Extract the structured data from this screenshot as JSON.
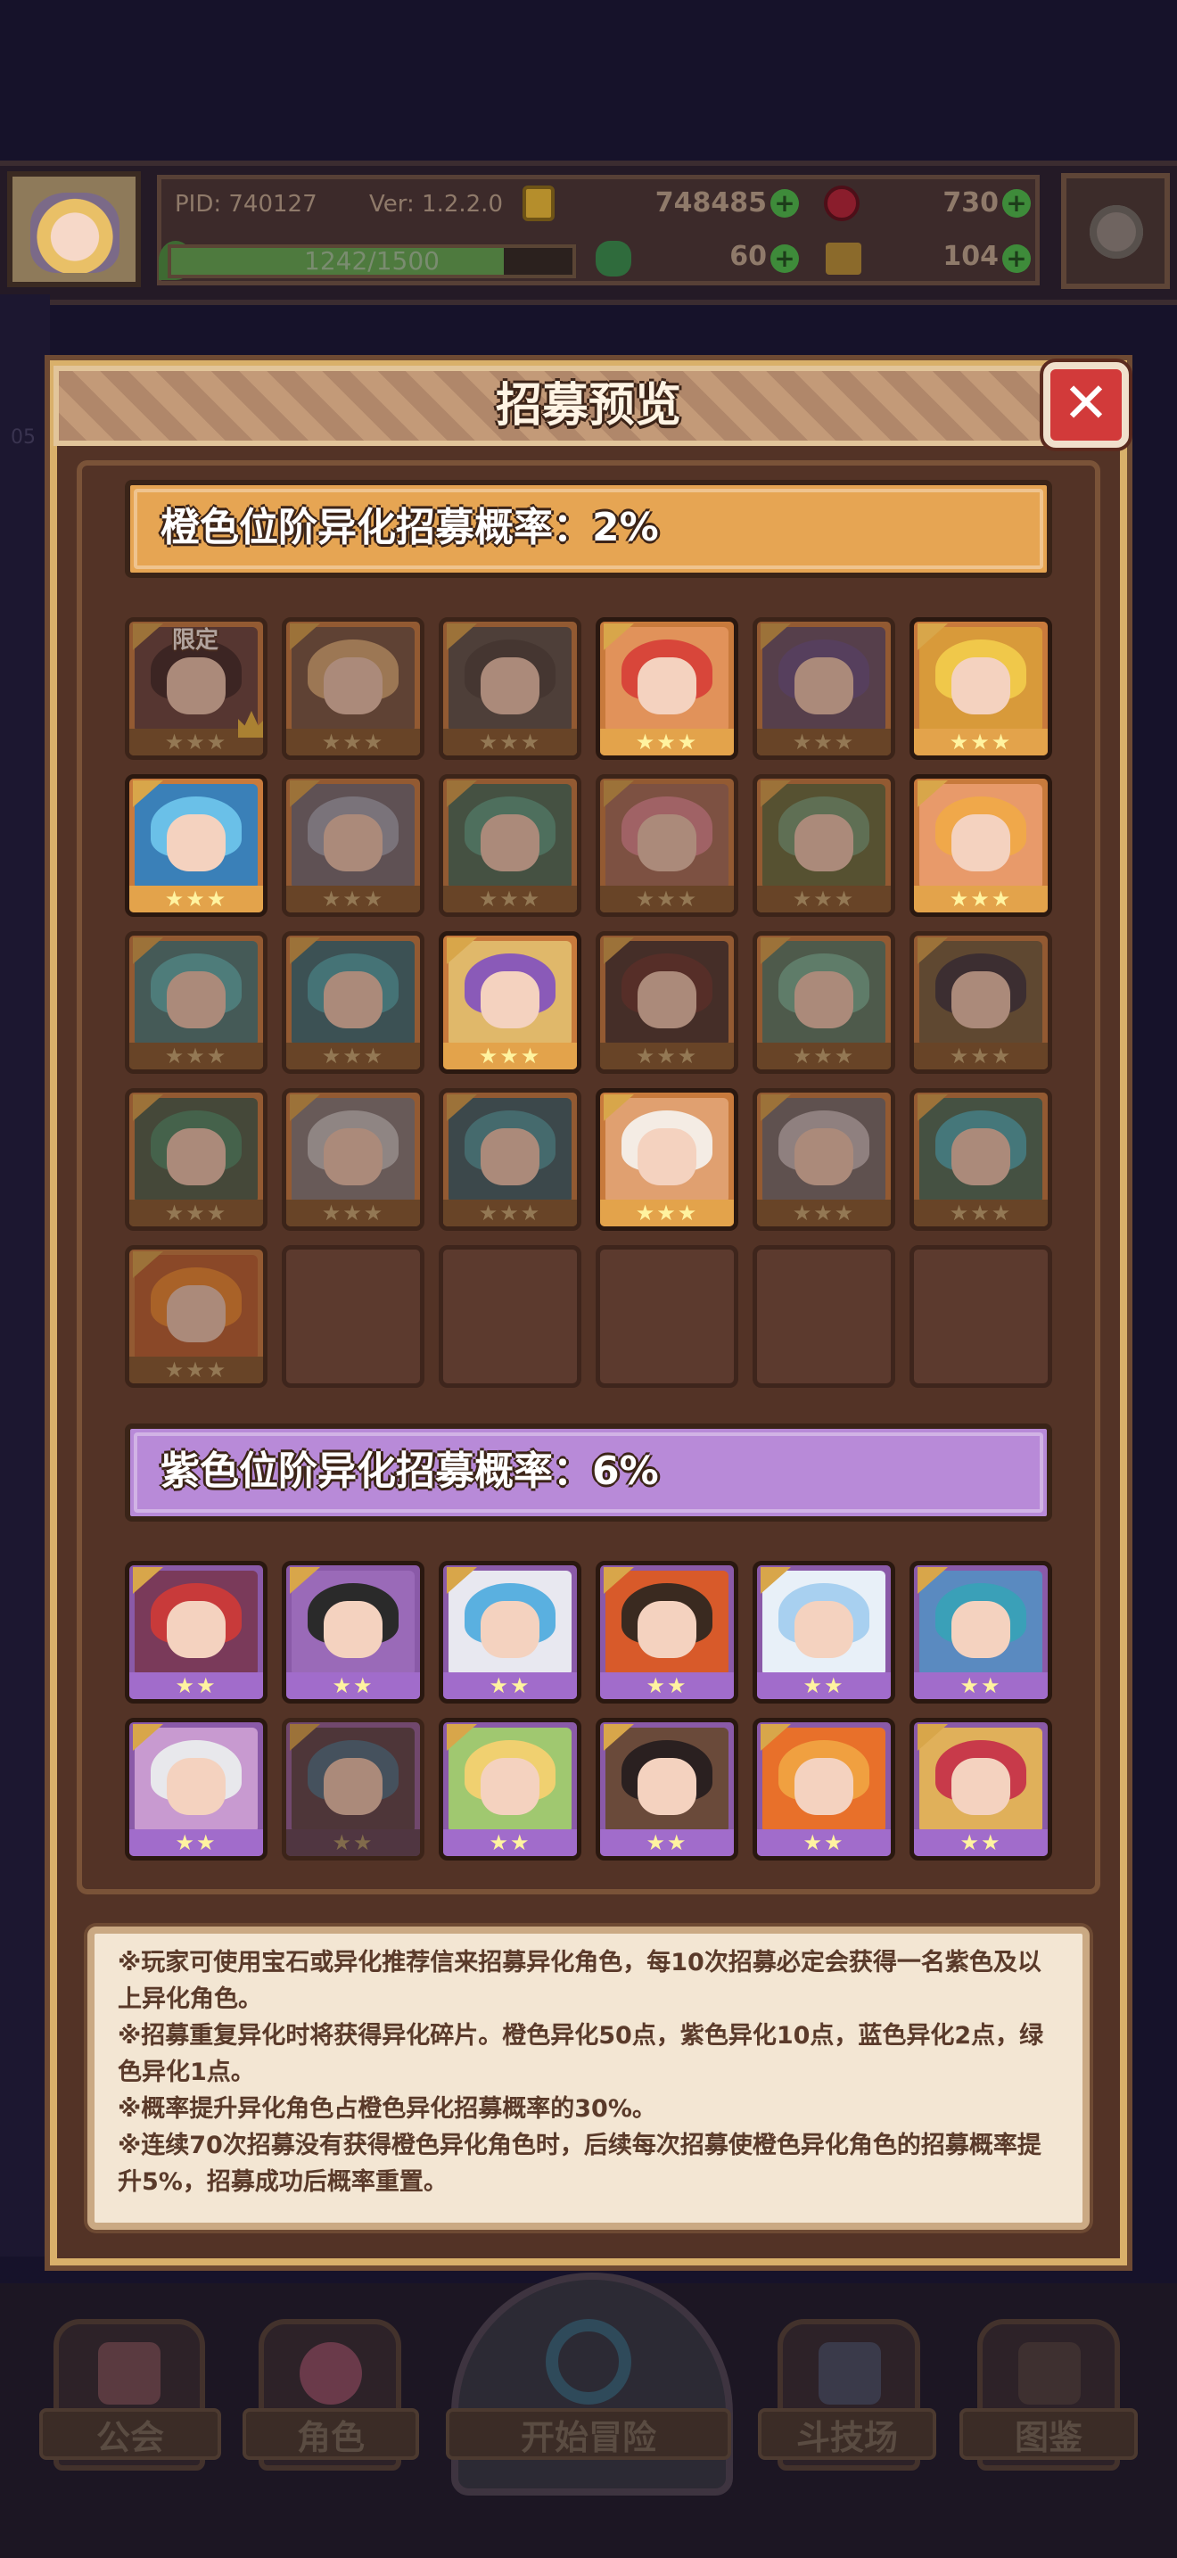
{
  "status": {
    "pid": "PID: 740127",
    "version": "Ver: 1.2.2.0",
    "gold": "748485",
    "gems": "730",
    "stamina": "1242/1500",
    "stamina_progress": 0.828,
    "clovers": "60",
    "keys": "104"
  },
  "modal": {
    "title": "招募预览",
    "close_icon": "✕"
  },
  "orange_tier": {
    "label": "橙色位阶异化招募概率：2%",
    "limited_tag": "限定",
    "stars": "★★★",
    "color": "#e6a553",
    "cards": [
      {
        "hair": "#2a1a22",
        "art": "#5a3a3a",
        "dim": true,
        "limited": true
      },
      {
        "hair": "#d9b07a",
        "art": "#6a5040",
        "dim": true
      },
      {
        "hair": "#3a3a3a",
        "art": "#4a4a4a",
        "dim": true
      },
      {
        "hair": "#d8463a",
        "art": "#e1925a",
        "dim": false
      },
      {
        "hair": "#5a4a8a",
        "art": "#5a4a6a",
        "dim": true
      },
      {
        "hair": "#f0c84a",
        "art": "#d89a3a",
        "dim": false
      },
      {
        "hair": "#6ac0e8",
        "art": "#3a80b8",
        "dim": false
      },
      {
        "hair": "#9aa8c0",
        "art": "#6a6a7a",
        "dim": true
      },
      {
        "hair": "#4aa08a",
        "art": "#3a6a5a",
        "dim": true
      },
      {
        "hair": "#e08a9a",
        "art": "#a06a5a",
        "dim": true
      },
      {
        "hair": "#6aa07a",
        "art": "#5a6a3a",
        "dim": true
      },
      {
        "hair": "#f0a84a",
        "art": "#e89a6a",
        "dim": false
      },
      {
        "hair": "#4ab8c0",
        "art": "#3a7a80",
        "dim": true
      },
      {
        "hair": "#3aa8b8",
        "art": "#2a6a7a",
        "dim": true
      },
      {
        "hair": "#8a5ab8",
        "art": "#e0b86a",
        "dim": false
      },
      {
        "hair": "#5a2a2a",
        "art": "#3a2a2a",
        "dim": true
      },
      {
        "hair": "#6ab8a0",
        "art": "#4a7a6a",
        "dim": true
      },
      {
        "hair": "#2a2a3a",
        "art": "#6a5a3a",
        "dim": true
      },
      {
        "hair": "#3a8a6a",
        "art": "#3a5a4a",
        "dim": true
      },
      {
        "hair": "#c0c8d0",
        "art": "#7a7a82",
        "dim": true
      },
      {
        "hair": "#3a98a8",
        "art": "#2a5a6a",
        "dim": true
      },
      {
        "hair": "#f4ece4",
        "art": "#e0a070",
        "dim": false
      },
      {
        "hair": "#c0c0c8",
        "art": "#6a6a72",
        "dim": true
      },
      {
        "hair": "#3ab0c0",
        "art": "#3a6a5a",
        "dim": true
      },
      {
        "hair": "#f08a2a",
        "art": "#b85a2a",
        "dim": true
      }
    ]
  },
  "purple_tier": {
    "label": "紫色位阶异化招募概率：6%",
    "stars": "★★",
    "color": "#b88ad8",
    "cards": [
      {
        "hair": "#c83a3a",
        "art": "#7a3a5a",
        "dim": false
      },
      {
        "hair": "#2a2a2a",
        "art": "#9a6ab8",
        "dim": false
      },
      {
        "hair": "#5ab0e0",
        "art": "#e8e8f0",
        "dim": false
      },
      {
        "hair": "#3a2a20",
        "art": "#d85a2a",
        "dim": false
      },
      {
        "hair": "#a8d0f0",
        "art": "#e8f0f8",
        "dim": false
      },
      {
        "hair": "#3aa0b8",
        "art": "#5a8ac0",
        "dim": false
      },
      {
        "hair": "#e8e8ec",
        "art": "#c89ad0",
        "dim": false
      },
      {
        "hair": "#3a6a8a",
        "art": "#4a3a4a",
        "dim": true
      },
      {
        "hair": "#f0d070",
        "art": "#a0c870",
        "dim": false
      },
      {
        "hair": "#2a2020",
        "art": "#6a4a3a",
        "dim": false
      },
      {
        "hair": "#f0a040",
        "art": "#e8702a",
        "dim": false
      },
      {
        "hair": "#c83a4a",
        "art": "#e0b05a",
        "dim": false
      }
    ]
  },
  "notes": [
    "※玩家可使用宝石或异化推荐信来招募异化角色，每10次招募必定会获得一名紫色及以",
    "上异化角色。",
    "※招募重复异化时将获得异化碎片。橙色异化50点，紫色异化10点，蓝色异化2点，绿",
    "色异化1点。",
    "※概率提升异化角色占橙色异化招募概率的30%。",
    "※连续70次招募没有获得橙色异化角色时，后续每次招募使橙色异化角色的招募概率提",
    "升5%，招募成功后概率重置。"
  ],
  "nav": {
    "guild": "公会",
    "characters": "角色",
    "adventure": "开始冒险",
    "arena": "斗技场",
    "codex": "图鉴"
  },
  "side_hint": "05"
}
